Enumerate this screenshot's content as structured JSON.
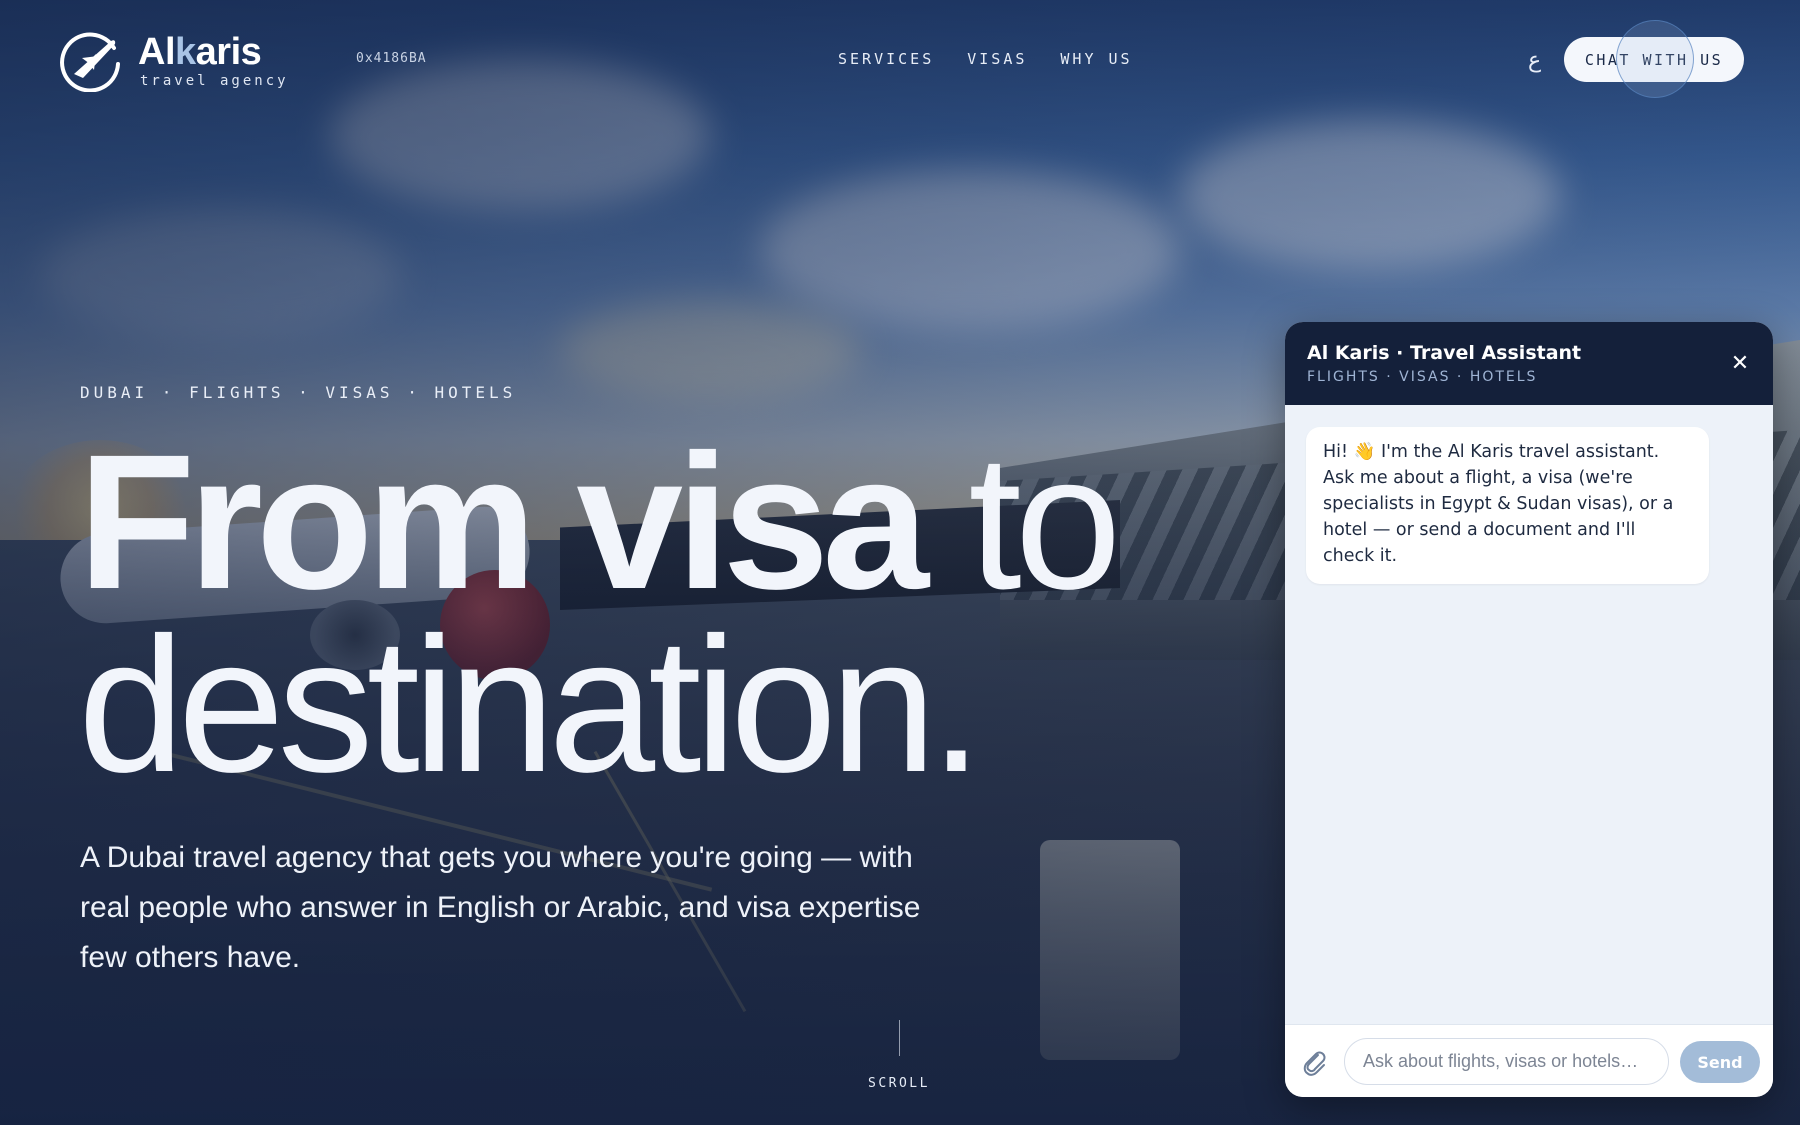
{
  "brand": {
    "name_part1": "Al",
    "name_part2": "k",
    "name_part3": "aris",
    "tagline": "travel agency",
    "hex_code": "0x4186BA"
  },
  "nav": {
    "items": [
      {
        "label": "SERVICES"
      },
      {
        "label": "VISAS"
      },
      {
        "label": "WHY US"
      }
    ],
    "language_toggle": "ع",
    "cta_label": "CHAT WITH US"
  },
  "hero": {
    "eyebrow": "DUBAI · FLIGHTS · VISAS · HOTELS",
    "headline_bold": "From visa",
    "headline_light_1": "to",
    "headline_light_2": "destination.",
    "lede": "A Dubai travel agency that gets you where you're going — with real people who answer in English or Arabic, and visa expertise few others have.",
    "scroll_label": "SCROLL"
  },
  "chat": {
    "title": "Al Karis · Travel Assistant",
    "subtitle": "FLIGHTS · VISAS · HOTELS",
    "close_glyph": "✕",
    "messages": [
      {
        "from": "assistant",
        "text": "Hi! 👋 I'm the Al Karis travel assistant. Ask me about a flight, a visa (we're specialists in Egypt & Sudan visas), or a hotel — or send a document and I'll check it."
      }
    ],
    "input_placeholder": "Ask about flights, visas or hotels…",
    "input_value": "",
    "send_label": "Send"
  },
  "colors": {
    "navy": "#14203a",
    "accent": "#a9c4e6",
    "send_button": "#a3bcd8",
    "panel_bg": "#edf2f9"
  },
  "icons": {
    "logo": "plane-in-circle-icon",
    "close": "close-icon",
    "attach": "paperclip-icon"
  }
}
